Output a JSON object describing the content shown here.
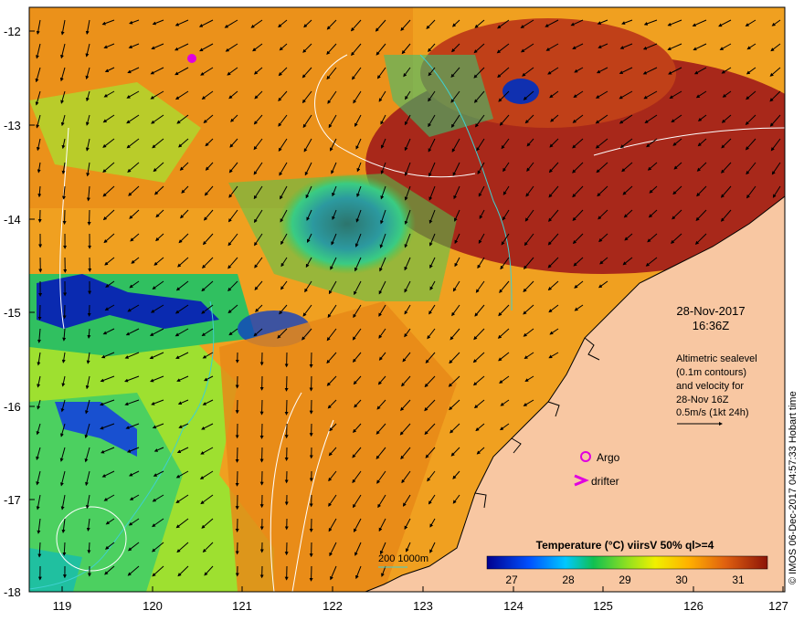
{
  "map": {
    "date": "28-Nov-2017",
    "time": "16:36Z",
    "altimetry_note": [
      "Altimetric sealevel",
      "(0.1m contours)",
      "and velocity for",
      "28-Nov 16Z",
      "0.5m/s (1kt 24h)"
    ],
    "x_ticks": [
      "119",
      "120",
      "121",
      "122",
      "123",
      "124",
      "125",
      "126",
      "127"
    ],
    "y_ticks": [
      "-12",
      "-13",
      "-14",
      "-15",
      "-16",
      "-17",
      "-18"
    ],
    "legend": {
      "argo_label": "Argo",
      "drifter_label": "drifter",
      "depth_label": "200  1000m"
    },
    "colorbar": {
      "title": "Temperature (°C) viirsV 50% ql>=4",
      "ticks": [
        "27",
        "28",
        "29",
        "30",
        "31"
      ]
    },
    "credit": "© IMOS 06-Dec-2017 04:57:33 Hobart time",
    "colors": {
      "land": "#f8c7a2",
      "cold": "#0a1a8c",
      "warm": "#8c1408",
      "argo": "#e000e0",
      "contour": "#ffffff",
      "bathymetry": "#3fd0d0"
    }
  }
}
